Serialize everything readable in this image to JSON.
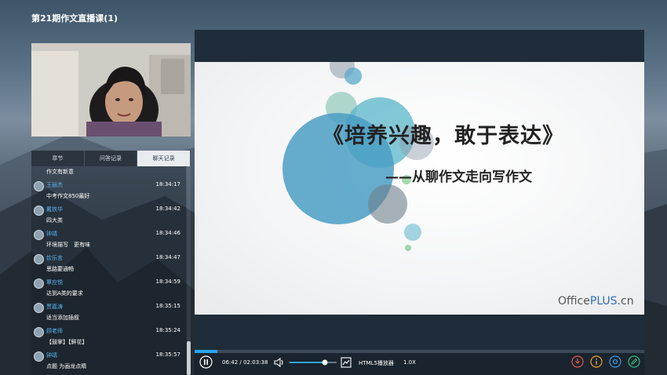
{
  "window": {
    "title": "第21期作文直播课(1)"
  },
  "tabs": [
    {
      "label": "章节"
    },
    {
      "label": "问答记录"
    },
    {
      "label": "聊天记录"
    }
  ],
  "chat": {
    "first_text": "作文有新意",
    "messages": [
      {
        "name": "王丽杰",
        "time": "18:34:17",
        "text": "中考作文850最好"
      },
      {
        "name": "戴铁华",
        "time": "18:34:42",
        "text": "四大类"
      },
      {
        "name": "钟靖",
        "time": "18:34:46",
        "text": "环境描写　更有味"
      },
      {
        "name": "钦乐言",
        "time": "18:34:47",
        "text": "思路要通畅"
      },
      {
        "name": "覃应悦",
        "time": "18:34:59",
        "text": "达到A类的要求"
      },
      {
        "name": "贾嘉涛",
        "time": "18:35:15",
        "text": "适当添加插叙"
      },
      {
        "name": "顾老师",
        "time": "18:35:24",
        "text": "【鼓掌】【鲜花】"
      },
      {
        "name": "钟靖",
        "time": "18:35:57",
        "text": "点题 为画龙点睛"
      }
    ]
  },
  "slide": {
    "title": "《培养兴趣，敢于表达》",
    "subtitle": "——从聊作文走向写作文",
    "brand_prefix": "Office",
    "brand_plus": "PLUS",
    "brand_suffix": ".cn"
  },
  "player": {
    "time_display": "06:42 / 02:03:38",
    "player_name": "HTML5播放器",
    "speed": "1.0X",
    "progress": 0.054,
    "volume": 0.75,
    "icons": [
      "pause-icon",
      "volume-icon",
      "fullscreen-icon",
      "download-icon",
      "info-icon",
      "settings-icon",
      "pen-icon"
    ]
  },
  "colors": {
    "accent": "#2aa4f0",
    "name": "#5ab4f0",
    "slide_circle": "#4a9ec4",
    "brand_plus": "#2d6fb7"
  }
}
